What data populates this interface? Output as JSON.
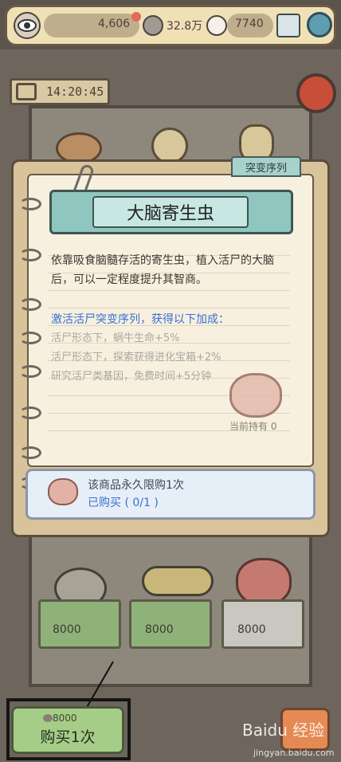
{
  "currency": {
    "gold": "4,606",
    "brain": "32.8万",
    "ghost": "7740"
  },
  "timer": "14:20:45",
  "tag": "突变序列",
  "item": {
    "name": "大脑寄生虫",
    "description_l1": "依靠吸食脑髓存活的寄生虫，植入活尸的大脑",
    "description_l2": "后，可以一定程度提升其智商。",
    "bonus_title": "激活活尸突变序列，获得以下加成：",
    "bonus1": "活尸形态下，蜗牛生命+5%",
    "bonus2": "活尸形态下，探索获得进化宝箱+2%",
    "bonus3": "研究活尸类基因，免费时间+5分钟",
    "held": "当前持有 0"
  },
  "limit": {
    "line1": "该商品永久限购1次",
    "line2": "已购买 ( 0/1 )"
  },
  "shop_items": [
    {
      "price": "8000"
    },
    {
      "price": "8000"
    },
    {
      "price": "8000"
    }
  ],
  "buy": {
    "cost": "8000",
    "label": "购买1次"
  },
  "watermark": {
    "main": "Baidu 经验",
    "sub": "jingyan.baidu.com"
  }
}
